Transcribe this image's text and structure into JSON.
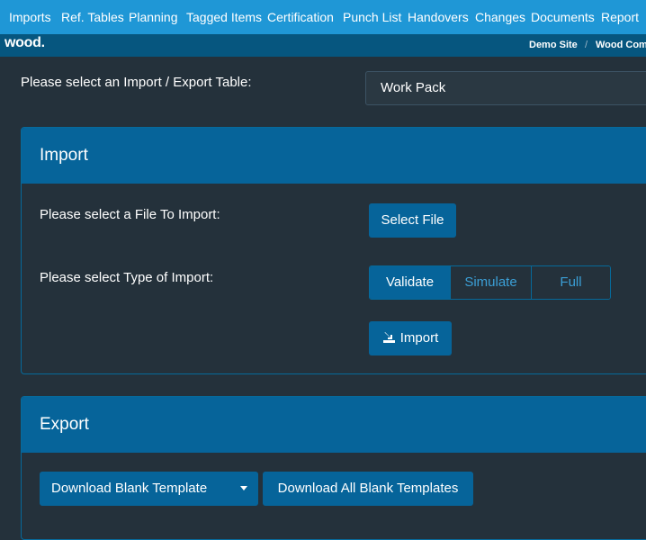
{
  "nav": {
    "items": [
      "Imports",
      "Ref. Tables",
      "Planning",
      "Tagged Items",
      "Certification",
      "Punch List",
      "Handovers",
      "Changes",
      "Documents",
      "Report"
    ]
  },
  "subbar": {
    "logo": "wood",
    "logo_dot": ".",
    "breadcrumbs": [
      "Demo Site",
      "Wood Comm"
    ],
    "separator": "/"
  },
  "table_select": {
    "label": "Please select an Import / Export Table:",
    "value": "Work Pack"
  },
  "import_panel": {
    "title": "Import",
    "file_label": "Please select a File To Import:",
    "select_file_button": "Select File",
    "type_label": "Please select Type of Import:",
    "type_options": [
      "Validate",
      "Simulate",
      "Full"
    ],
    "selected_type": "Validate",
    "import_button": "Import"
  },
  "export_panel": {
    "title": "Export",
    "download_template_button": "Download Blank Template",
    "download_all_button": "Download All Blank Templates"
  },
  "colors": {
    "nav_bg": "#1f97d6",
    "subbar_bg": "#06567f",
    "page_bg": "#24313b",
    "accent": "#06649a"
  }
}
